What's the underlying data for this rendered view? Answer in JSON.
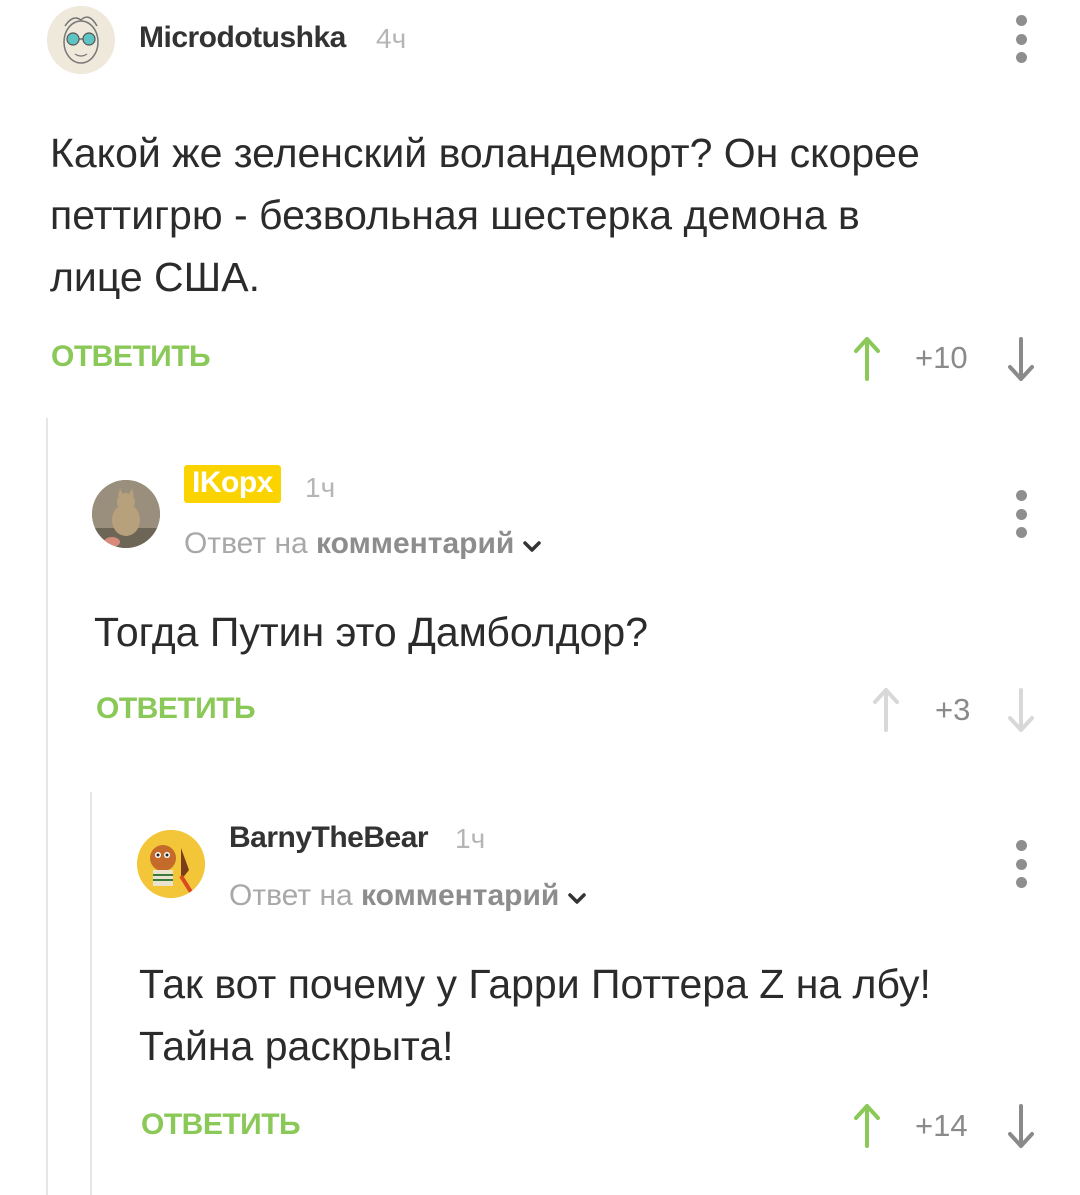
{
  "colors": {
    "accent": "#8ac858",
    "username_highlight": "#fbd400"
  },
  "comments": [
    {
      "username": "Microdotushka",
      "time": "4ч",
      "text": "Какой же зеленский воландеморт? Он скорее\nпеттигрю - безвольная шестерка  демона в\nлице США.",
      "reply_label": "ОТВЕТИТЬ",
      "score": "+10",
      "vote_state": "upvoted"
    },
    {
      "username": "IKopx",
      "time": "1ч",
      "reply_to_prefix": "Ответ на",
      "reply_to_link": "комментарий",
      "text": "Тогда Путин это Дамболдор?",
      "reply_label": "ОТВЕТИТЬ",
      "score": "+3",
      "vote_state": "none"
    },
    {
      "username": "BarnyTheBear",
      "time": "1ч",
      "reply_to_prefix": "Ответ на",
      "reply_to_link": "комментарий",
      "text": "Так вот почему у Гарри Поттера Z на лбу!\nТайна раскрыта!",
      "reply_label": "ОТВЕТИТЬ",
      "score": "+14",
      "vote_state": "upvoted"
    }
  ]
}
